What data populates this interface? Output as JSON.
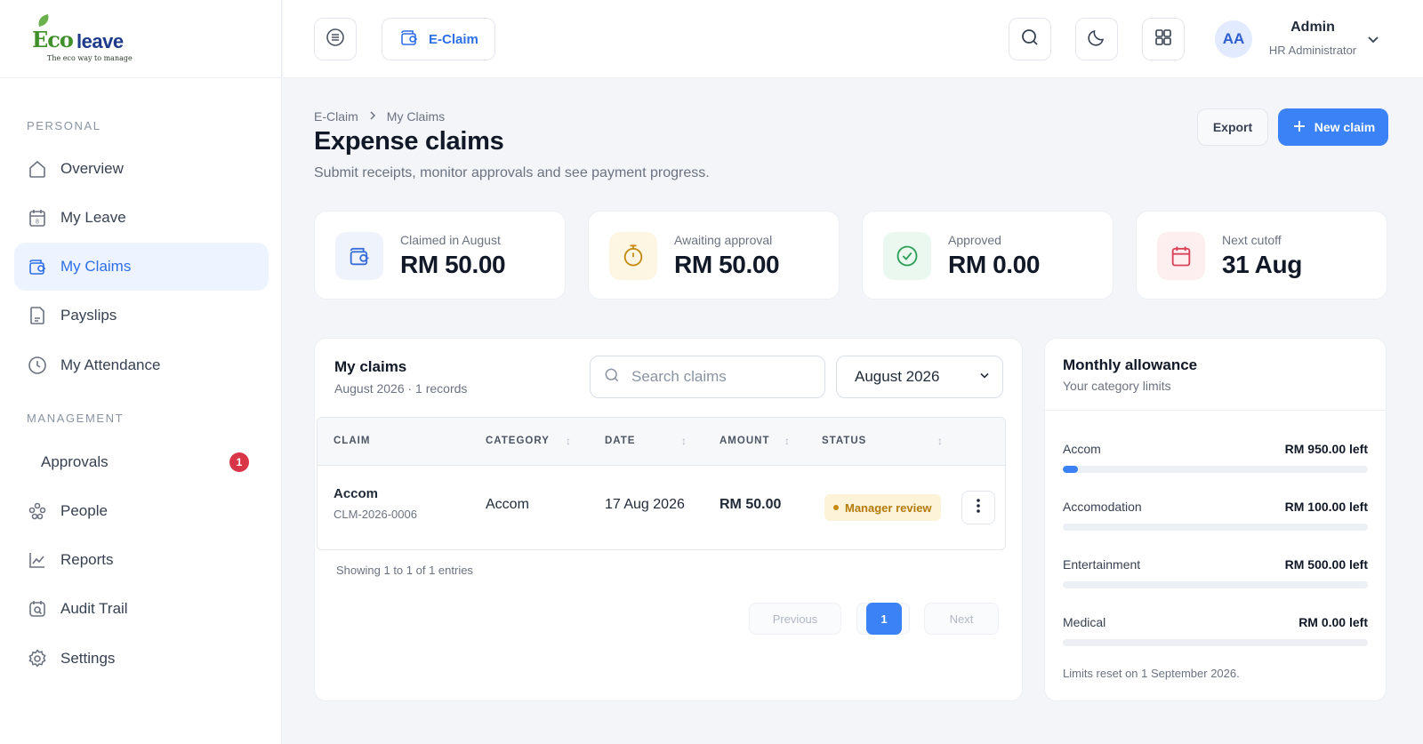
{
  "brand": {
    "logo_eco": "Eco",
    "logo_leave": "leave",
    "tagline": "The eco way to manage"
  },
  "sidebar": {
    "section_personal": "PERSONAL",
    "section_management": "MANAGEMENT",
    "items": [
      {
        "label": "Overview",
        "icon": "home-icon"
      },
      {
        "label": "My Leave",
        "icon": "calendar-icon"
      },
      {
        "label": "My Claims",
        "icon": "wallet-icon",
        "active": true
      },
      {
        "label": "Payslips",
        "icon": "document-icon"
      },
      {
        "label": "My Attendance",
        "icon": "clock-icon"
      },
      {
        "label": "Approvals",
        "badge": "1"
      },
      {
        "label": "People",
        "icon": "people-icon"
      },
      {
        "label": "Reports",
        "icon": "chart-icon"
      },
      {
        "label": "Audit Trail",
        "icon": "audit-icon"
      },
      {
        "label": "Settings",
        "icon": "gear-icon"
      }
    ]
  },
  "topbar": {
    "module_chip": "E-Claim",
    "user_initials": "AA",
    "user_name": "Admin",
    "user_role": "HR Administrator"
  },
  "page": {
    "breadcrumb": [
      "E-Claim",
      "My Claims"
    ],
    "title": "Expense claims",
    "subtitle": "Submit receipts, monitor approvals and see payment progress.",
    "export_label": "Export",
    "new_claim_label": "New claim"
  },
  "stats": [
    {
      "label": "Claimed in August",
      "value": "RM 50.00",
      "icon": "wallet-icon",
      "color": "#eef3fc"
    },
    {
      "label": "Awaiting approval",
      "value": "RM 50.00",
      "icon": "timer-icon",
      "color": "#fdf6e3"
    },
    {
      "label": "Approved",
      "value": "RM 0.00",
      "icon": "check-circle-icon",
      "color": "#eaf8ef"
    },
    {
      "label": "Next cutoff",
      "value": "31 Aug",
      "icon": "calendar-icon",
      "color": "#fdeef0"
    }
  ],
  "claims": {
    "title": "My claims",
    "subtitle": "August 2026 · 1 records",
    "search_placeholder": "Search claims",
    "month": "August 2026",
    "columns": [
      "CLAIM",
      "CATEGORY",
      "DATE",
      "AMOUNT",
      "STATUS"
    ],
    "rows": [
      {
        "claim": "Accom",
        "id": "CLM-2026-0006",
        "category": "Accom",
        "date": "17 Aug 2026",
        "amount": "RM 50.00",
        "status": "Manager review"
      }
    ],
    "showing": "Showing 1 to 1 of 1 entries",
    "pagination": {
      "previous": "Previous",
      "page": "1",
      "next": "Next"
    }
  },
  "allowance": {
    "title": "Monthly allowance",
    "subtitle": "Your category limits",
    "items": [
      {
        "name": "Accom",
        "left": "RM 950.00 left",
        "used_fraction": 0.05
      },
      {
        "name": "Accomodation",
        "left": "RM 100.00 left",
        "used_fraction": 0
      },
      {
        "name": "Entertainment",
        "left": "RM 500.00 left",
        "used_fraction": 0
      },
      {
        "name": "Medical",
        "left": "RM 0.00 left",
        "used_fraction": 0
      }
    ],
    "footer": "Limits reset on 1 September 2026."
  }
}
